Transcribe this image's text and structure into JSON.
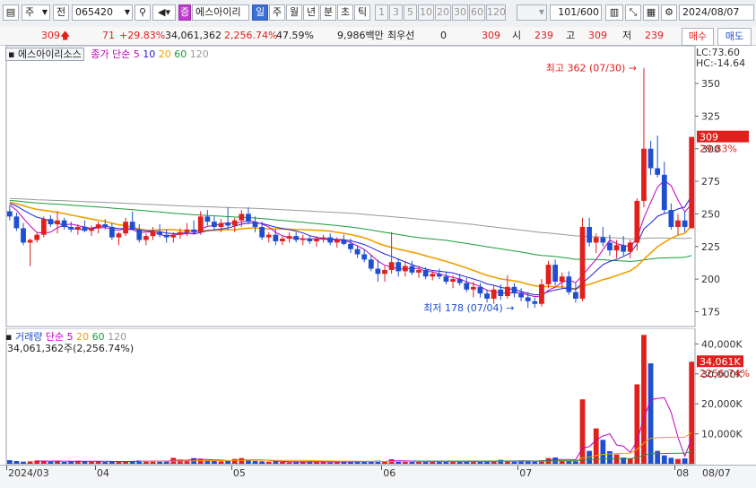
{
  "toolbar": {
    "period_label": "주",
    "prev_label": "전",
    "code_value": "065420",
    "badge_label": "증",
    "stock_name": "에스아이리",
    "period_tabs": [
      "일",
      "주",
      "월",
      "년",
      "분",
      "초",
      "틱"
    ],
    "selected_tab": "일",
    "intervals": [
      "1",
      "3",
      "5",
      "10",
      "20",
      "30",
      "60",
      "120"
    ],
    "count_value": "101",
    "count_total": "/600",
    "date_value": "2024/08/07"
  },
  "quote": {
    "price": "309",
    "change": "71",
    "change_pct": "+29.83%",
    "volume": "34,061,362",
    "volume_ratio": "2,256.74%",
    "turnover": "47.59%",
    "amount": "9,986백만",
    "ask_label": "최우선",
    "ask_value": "0",
    "best_value": "309",
    "open_label": "시",
    "open_value": "239",
    "high_label": "고",
    "high_value": "309",
    "low_label": "저",
    "low_value": "239",
    "buy_label": "매수",
    "sell_label": "매도"
  },
  "colors": {
    "up": "#e0201d",
    "down": "#1d4fd0",
    "ma5": "#c000c0",
    "ma10": "#2323d8",
    "ma20": "#f0a000",
    "ma60": "#1a9a3c",
    "ma120": "#999999"
  },
  "chart_data": [
    {
      "type": "candlestick",
      "title": "에스아이리소스",
      "legend": {
        "prefix": "종가 단순",
        "periods": [
          "5",
          "10",
          "20",
          "60",
          "120"
        ]
      },
      "y_ticks": [
        "350",
        "325",
        "300",
        "275",
        "250",
        "225",
        "200",
        "175"
      ],
      "ylim": [
        165,
        370
      ],
      "right_labels": {
        "lc": "LC:73.60",
        "hc": "HC:-14.64",
        "price": "309",
        "pct": "29.83%"
      },
      "annotations": {
        "high": "최고 362 (07/30)",
        "low": "최저 178 (07/04)"
      },
      "candles": [
        [
          252,
          256,
          245,
          248
        ],
        [
          248,
          251,
          237,
          239
        ],
        [
          239,
          243,
          226,
          228
        ],
        [
          228,
          231,
          210,
          230
        ],
        [
          230,
          236,
          228,
          234
        ],
        [
          234,
          248,
          232,
          246
        ],
        [
          246,
          249,
          240,
          242
        ],
        [
          242,
          252,
          235,
          245
        ],
        [
          245,
          247,
          238,
          240
        ],
        [
          240,
          244,
          236,
          238
        ],
        [
          238,
          242,
          234,
          240
        ],
        [
          240,
          245,
          236,
          237
        ],
        [
          237,
          241,
          233,
          239
        ],
        [
          239,
          244,
          235,
          242
        ],
        [
          242,
          246,
          238,
          240
        ],
        [
          240,
          243,
          230,
          232
        ],
        [
          232,
          236,
          226,
          235
        ],
        [
          235,
          247,
          233,
          244
        ],
        [
          244,
          252,
          240,
          238
        ],
        [
          238,
          242,
          228,
          230
        ],
        [
          230,
          235,
          226,
          233
        ],
        [
          233,
          240,
          230,
          236
        ],
        [
          236,
          242,
          232,
          234
        ],
        [
          234,
          238,
          228,
          232
        ],
        [
          232,
          236,
          228,
          234
        ],
        [
          234,
          239,
          231,
          236
        ],
        [
          236,
          243,
          233,
          238
        ],
        [
          238,
          245,
          234,
          236
        ],
        [
          236,
          252,
          234,
          248
        ],
        [
          248,
          253,
          241,
          244
        ],
        [
          244,
          248,
          238,
          240
        ],
        [
          240,
          246,
          236,
          243
        ],
        [
          243,
          255,
          238,
          241
        ],
        [
          241,
          247,
          236,
          245
        ],
        [
          245,
          253,
          240,
          250
        ],
        [
          250,
          255,
          242,
          244
        ],
        [
          244,
          248,
          236,
          240
        ],
        [
          240,
          244,
          230,
          232
        ],
        [
          232,
          236,
          228,
          234
        ],
        [
          234,
          238,
          226,
          229
        ],
        [
          229,
          233,
          226,
          231
        ],
        [
          231,
          236,
          228,
          233
        ],
        [
          233,
          236,
          228,
          230
        ],
        [
          230,
          234,
          226,
          231
        ],
        [
          231,
          233,
          227,
          229
        ],
        [
          229,
          233,
          225,
          231
        ],
        [
          231,
          234,
          228,
          232
        ],
        [
          232,
          235,
          226,
          228
        ],
        [
          228,
          232,
          224,
          230
        ],
        [
          230,
          234,
          226,
          227
        ],
        [
          227,
          231,
          220,
          223
        ],
        [
          223,
          226,
          216,
          219
        ],
        [
          219,
          223,
          213,
          215
        ],
        [
          215,
          219,
          206,
          208
        ],
        [
          208,
          215,
          198,
          204
        ],
        [
          204,
          210,
          198,
          207
        ],
        [
          207,
          236,
          204,
          213
        ],
        [
          213,
          216,
          202,
          206
        ],
        [
          206,
          213,
          202,
          210
        ],
        [
          210,
          214,
          203,
          205
        ],
        [
          205,
          210,
          201,
          207
        ],
        [
          207,
          209,
          200,
          202
        ],
        [
          202,
          206,
          199,
          204
        ],
        [
          204,
          208,
          200,
          202
        ],
        [
          202,
          205,
          196,
          198
        ],
        [
          198,
          203,
          193,
          200
        ],
        [
          200,
          204,
          195,
          197
        ],
        [
          197,
          201,
          190,
          192
        ],
        [
          192,
          198,
          186,
          194
        ],
        [
          194,
          197,
          186,
          189
        ],
        [
          189,
          192,
          182,
          185
        ],
        [
          185,
          195,
          181,
          192
        ],
        [
          192,
          196,
          184,
          187
        ],
        [
          187,
          203,
          185,
          194
        ],
        [
          194,
          197,
          186,
          189
        ],
        [
          189,
          193,
          183,
          186
        ],
        [
          186,
          190,
          178,
          183
        ],
        [
          183,
          186,
          178,
          181
        ],
        [
          181,
          200,
          179,
          196
        ],
        [
          196,
          214,
          193,
          211
        ],
        [
          211,
          215,
          195,
          198
        ],
        [
          198,
          205,
          193,
          202
        ],
        [
          202,
          206,
          188,
          190
        ],
        [
          190,
          197,
          182,
          185
        ],
        [
          185,
          247,
          183,
          240
        ],
        [
          240,
          247,
          225,
          228
        ],
        [
          228,
          235,
          220,
          232
        ],
        [
          232,
          240,
          225,
          228
        ],
        [
          228,
          234,
          218,
          222
        ],
        [
          222,
          230,
          216,
          226
        ],
        [
          226,
          233,
          218,
          221
        ],
        [
          221,
          230,
          216,
          228
        ],
        [
          228,
          262,
          222,
          260
        ],
        [
          260,
          362,
          255,
          300
        ],
        [
          300,
          306,
          280,
          285
        ],
        [
          285,
          310,
          278,
          280
        ],
        [
          280,
          290,
          250,
          253
        ],
        [
          253,
          258,
          238,
          240
        ],
        [
          240,
          250,
          234,
          245
        ],
        [
          245,
          252,
          236,
          240
        ],
        [
          239,
          309,
          239,
          309
        ]
      ]
    },
    {
      "type": "bar",
      "title": "거래량",
      "legend": {
        "prefix": "단순",
        "periods": [
          "5",
          "20",
          "60",
          "120"
        ]
      },
      "summary": "34,061,362주(2,256.74%)",
      "y_ticks": [
        "40,000K",
        "30,000K",
        "20,000K",
        "10,000K"
      ],
      "ylim": [
        0,
        44000
      ],
      "right_labels": {
        "value": "34,061K",
        "pct": "2256.74%"
      },
      "volumes": [
        1200,
        900,
        700,
        800,
        1100,
        1000,
        700,
        900,
        600,
        800,
        1000,
        900,
        700,
        800,
        600,
        900,
        800,
        700,
        900,
        1100,
        1000,
        800,
        700,
        900,
        2000,
        1400,
        1000,
        1900,
        1500,
        1100,
        900,
        800,
        1000,
        1600,
        1900,
        1200,
        900,
        800,
        700,
        900,
        600,
        500,
        700,
        600,
        800,
        700,
        600,
        500,
        700,
        800,
        900,
        700,
        600,
        800,
        1000,
        700,
        1500,
        900,
        700,
        600,
        700,
        800,
        900,
        700,
        600,
        800,
        700,
        900,
        800,
        700,
        800,
        900,
        1300,
        900,
        700,
        1100,
        800,
        900,
        1200,
        1900,
        2100,
        1100,
        900,
        800,
        21500,
        4300,
        11800,
        8000,
        4200,
        3100,
        2100,
        1800,
        26500,
        43000,
        33500,
        4300,
        2800,
        2000,
        1600,
        1800,
        34061
      ]
    }
  ],
  "date_axis": {
    "labels": [
      {
        "text": "2024/03",
        "i": 0
      },
      {
        "text": "04",
        "i": 13
      },
      {
        "text": "05",
        "i": 33
      },
      {
        "text": "06",
        "i": 55
      },
      {
        "text": "07",
        "i": 75
      },
      {
        "text": "08",
        "i": 98
      }
    ],
    "right_label": "08/07"
  }
}
